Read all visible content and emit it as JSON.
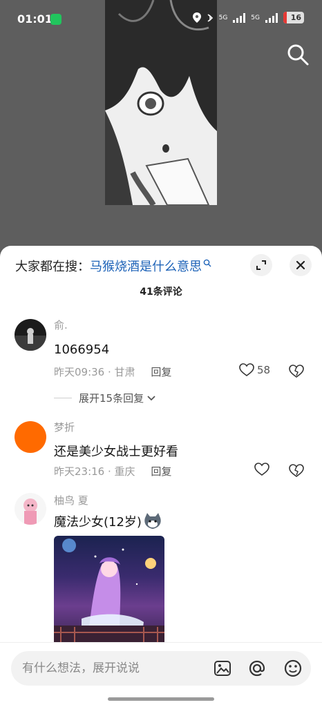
{
  "status_bar": {
    "time": "01:01",
    "network_1": "5G",
    "network_2": "5G",
    "battery": "16",
    "battery_level_percent": 16,
    "battery_color": "#e53935",
    "icons": [
      "wechat-icon",
      "location-icon",
      "alarm-icon",
      "signal-icon",
      "battery-icon"
    ]
  },
  "video": {
    "search_icon": "search-icon"
  },
  "sheet": {
    "hot_search_label": "大家都在搜：",
    "hot_search_keyword": "马猴烧酒是什么意思",
    "comment_count": "41条评论",
    "accent_color": "#1e63b8"
  },
  "comments": [
    {
      "username": "俞.",
      "text": "1066954",
      "time": "昨天09:36",
      "location": "甘肃",
      "reply_label": "回复",
      "likes": "58",
      "expand_label": "展开15条回复"
    },
    {
      "username": "梦折",
      "text": "还是美少女战士更好看",
      "time": "昨天23:16",
      "location": "重庆",
      "reply_label": "回复",
      "likes": ""
    },
    {
      "username": "柚鸟 夏",
      "text": "魔法少女(12岁)",
      "has_image": true
    }
  ],
  "input_bar": {
    "placeholder": "有什么想法，展开说说",
    "icons": [
      "image-icon",
      "at-icon",
      "emoji-icon"
    ]
  }
}
